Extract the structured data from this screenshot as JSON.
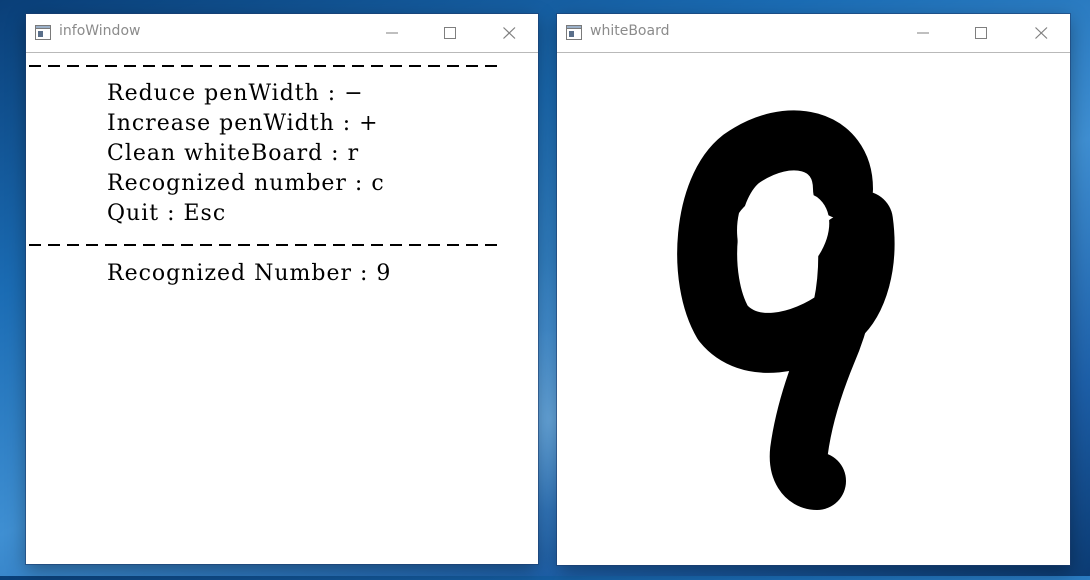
{
  "info_window": {
    "title": "infoWindow",
    "lines": [
      "Reduce penWidth : −",
      "Increase penWidth : +",
      "Clean whiteBoard : r",
      "Recognized number : c",
      "Quit : Esc"
    ],
    "result_line": "Recognized Number : 9"
  },
  "white_board": {
    "title": "whiteBoard",
    "drawn_digit": "9"
  }
}
